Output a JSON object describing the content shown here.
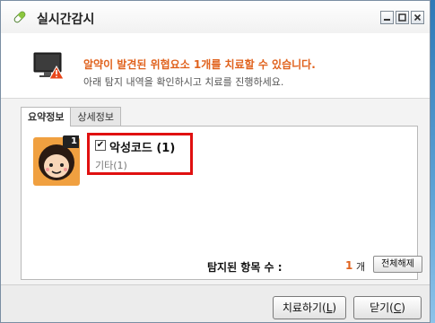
{
  "window": {
    "title": "실시간감시",
    "controls": [
      "minimize-icon",
      "maximize-icon",
      "close-icon"
    ]
  },
  "header": {
    "warning_text": "알약이 발견된 위협요소 1개를 치료할 수 있습니다.",
    "instruction_text": "아래 탐지 내역을 확인하시고 치료를 진행하세요.",
    "icon": "monitor-warning-icon"
  },
  "tabs": [
    {
      "label": "요약정보",
      "active": true
    },
    {
      "label": "상세정보",
      "active": false
    }
  ],
  "threat_item": {
    "badge": "1",
    "checked": true,
    "title": "악성코드 (1)",
    "subtitle": "기타(1)",
    "icon": "character-avatar-icon"
  },
  "summary": {
    "count_label": "탐지된 항목 수 :",
    "count_value": "1",
    "count_unit": "개",
    "clear_all_label": "전체해제"
  },
  "footer": {
    "treat_label": "치료하기(",
    "treat_key": "L",
    "close_label": "닫기(",
    "close_key": "C",
    "paren_close": ")"
  },
  "colors": {
    "accent_orange": "#e0621d",
    "highlight_red": "#e01010"
  }
}
